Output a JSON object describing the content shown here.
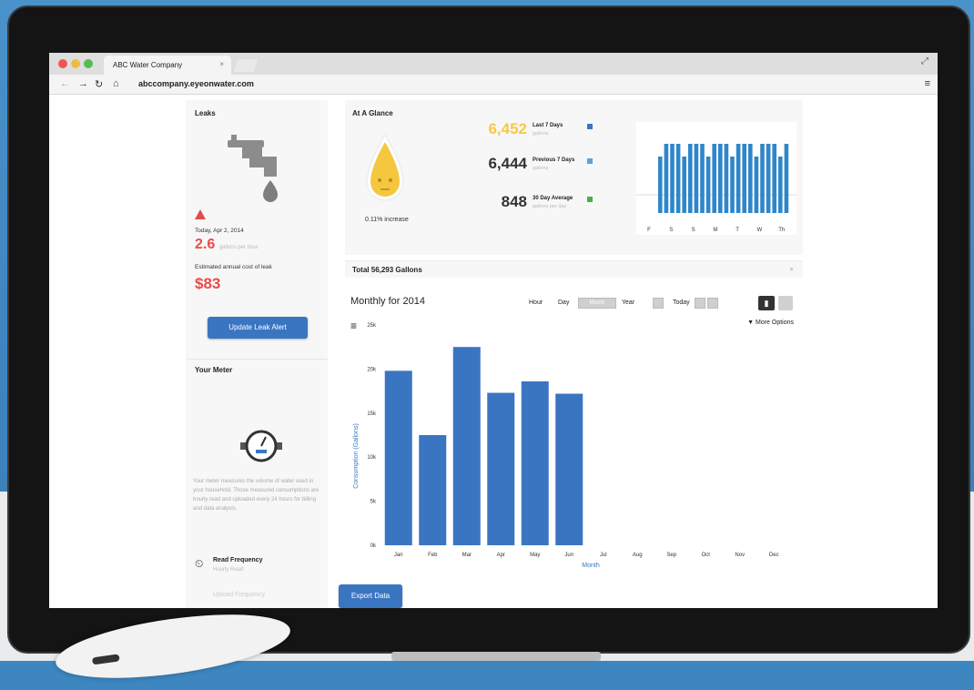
{
  "browser": {
    "tab_title": "ABC Water Company",
    "tab_close": "×",
    "url": "abccompany.eyeonwater.com"
  },
  "leaks": {
    "title": "Leaks",
    "date_label": "Today, Apr 2, 2014",
    "rate_value": "2.6",
    "rate_unit": "gallons per hour",
    "annual_cost_label": "Estimated annual cost of leak",
    "annual_cost_value": "$83",
    "update_button": "Update Leak Alert"
  },
  "meter": {
    "title": "Your Meter",
    "description": "Your meter measures the volume of water used in your household. Those measured consumptions are hourly read and uploaded every 24 hours for billing and data analysis.",
    "read_frequency_label": "Read Frequency",
    "read_frequency_value": "Hourly Read",
    "next_label": "Upload Frequency"
  },
  "glance": {
    "title": "At A Glance",
    "increase_text": "0.11% increase",
    "stats": [
      {
        "value": "6,452",
        "label": "Last 7 Days",
        "sub": "gallons",
        "color": "#f7c948",
        "square": "#3a75c2"
      },
      {
        "value": "6,444",
        "label": "Previous 7 Days",
        "sub": "gallons",
        "color": "#333333",
        "square": "#5aa3dc"
      },
      {
        "value": "848",
        "label": "30 Day Average",
        "sub": "gallons per day",
        "color": "#333333",
        "square": "#4cae4c"
      }
    ],
    "mini_days": [
      "F",
      "S",
      "S",
      "M",
      "T",
      "W",
      "Th"
    ]
  },
  "totals": {
    "title": "Total 56,293 Gallons",
    "subtitle": "Monthly for 2014",
    "ranges": [
      "Hour",
      "Day",
      "Month",
      "Year"
    ],
    "today_label": "Today",
    "more_options": "▼ More Options",
    "export_button": "Export Data"
  },
  "chart_data": {
    "type": "bar",
    "title": "",
    "xlabel": "Month",
    "ylabel": "Consumption (Gallons)",
    "categories": [
      "Jan",
      "Feb",
      "Mar",
      "Apr",
      "May",
      "Jun",
      "Jul",
      "Aug",
      "Sep",
      "Oct",
      "Nov",
      "Dec"
    ],
    "values": [
      19800,
      12500,
      22500,
      17300,
      18600,
      17200,
      null,
      null,
      null,
      null,
      null,
      null
    ],
    "ylim": [
      0,
      25000
    ],
    "yticks": [
      "0k",
      "5k",
      "10k",
      "15k",
      "20k",
      "25k"
    ],
    "bar_color": "#3a75c2",
    "grid": false,
    "legend": "none"
  }
}
